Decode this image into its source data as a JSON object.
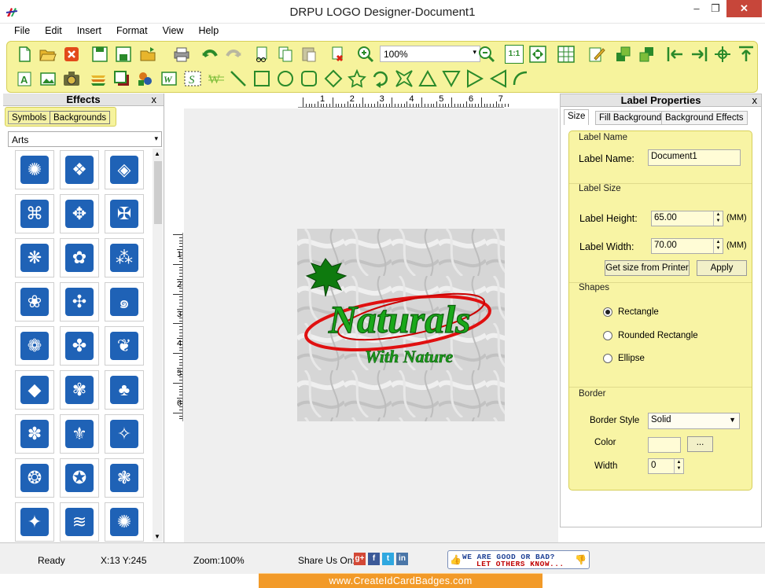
{
  "window": {
    "title": "DRPU LOGO Designer-Document1",
    "minimize": "–",
    "maximize": "❐",
    "close": "✕"
  },
  "menu": [
    "File",
    "Edit",
    "Insert",
    "Format",
    "View",
    "Help"
  ],
  "toolbar": {
    "zoom_value": "100%",
    "zoom_arrow": "▾",
    "actual_size_label": "1:1"
  },
  "effects": {
    "title": "Effects",
    "close": "x",
    "tabs": [
      "Symbols",
      "Backgrounds"
    ],
    "category": "Arts",
    "category_arrow": "▾",
    "scroll_up": "▲",
    "scroll_down": "▼"
  },
  "ruler": {
    "h": [
      "1",
      "2",
      "3",
      "4",
      "5",
      "6",
      "7"
    ],
    "v": [
      "1",
      "2",
      "3",
      "4",
      "5",
      "6"
    ]
  },
  "logo": {
    "text1": "Naturals",
    "text2": "With Nature"
  },
  "properties": {
    "title": "Label Properties",
    "close": "x",
    "tabs": [
      "Size",
      "Fill Background",
      "Background Effects"
    ],
    "label_name_group": "Label Name",
    "label_name_label": "Label Name:",
    "label_name_value": "Document1",
    "label_size_group": "Label Size",
    "height_label": "Label Height:",
    "height_value": "65.00",
    "width_label": "Label Width:",
    "width_value": "70.00",
    "unit": "(MM)",
    "printer_button": "Get size from Printer",
    "apply_button": "Apply",
    "shapes_group": "Shapes",
    "shapes": [
      "Rectangle",
      "Rounded Rectangle",
      "Ellipse"
    ],
    "selected_shape": "Rectangle",
    "border_group": "Border",
    "border_style_label": "Border Style",
    "border_style_value": "Solid",
    "color_label": "Color",
    "color_button": "...",
    "border_width_label": "Width",
    "border_width_value": "0"
  },
  "status": {
    "state": "Ready",
    "coords": "X:13  Y:245",
    "zoom": "Zoom:100%",
    "share": "Share Us On:",
    "feedback1": "WE ARE GOOD OR BAD?",
    "feedback2": "LET OTHERS KNOW...",
    "social": [
      "g+",
      "f",
      "t",
      "in"
    ]
  },
  "footer": "www.CreateIdCardBadges.com",
  "colors": {
    "toolbar_bg": "#f6f39c",
    "accent_blue": "#1f62b6",
    "logo_green": "#1aa81a",
    "logo_red": "#e01010",
    "footer": "#f29a28"
  },
  "symbol_icons": [
    "triskele",
    "knot",
    "diamond-knot",
    "square-knot",
    "quad-diamond",
    "celtic-x",
    "celtic-knot",
    "ring-knot",
    "braid",
    "flower-square",
    "dots-cross",
    "spiral",
    "lotus",
    "swirl",
    "leaf-square",
    "diamond",
    "shell",
    "crown-leaf",
    "fan",
    "lily",
    "triple-spiral",
    "medallion",
    "scroll",
    "wheel",
    "floral-cross",
    "wave",
    "swirl-triskele"
  ]
}
